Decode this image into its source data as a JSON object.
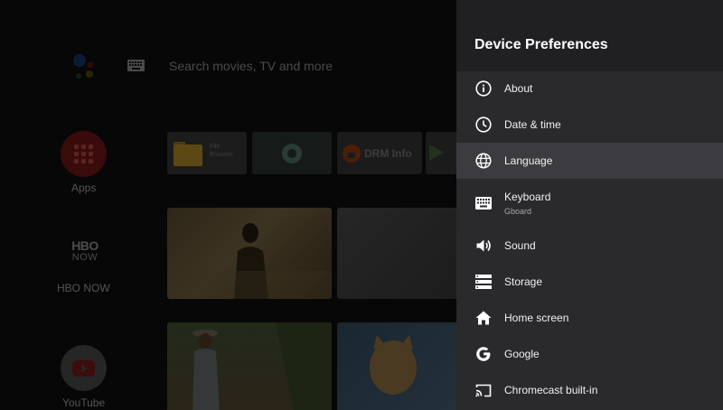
{
  "home": {
    "search_placeholder": "Search movies, TV and more",
    "favorites": [
      {
        "label": "Apps"
      },
      {
        "label": "HBO NOW",
        "logo_top": "HBO",
        "logo_bottom": "NOW"
      },
      {
        "label": "YouTube"
      }
    ],
    "app_tiles": [
      {
        "title": "File",
        "subtitle": "Browser"
      },
      {
        "title": ""
      },
      {
        "title": "DRM Info"
      },
      {
        "title": ""
      }
    ]
  },
  "panel": {
    "title": "Device Preferences",
    "items": [
      {
        "label": "About",
        "icon": "info-icon"
      },
      {
        "label": "Date & time",
        "icon": "clock-icon"
      },
      {
        "label": "Language",
        "icon": "globe-icon",
        "selected": true
      },
      {
        "label": "Keyboard",
        "sublabel": "Gboard",
        "icon": "keyboard-icon"
      },
      {
        "label": "Sound",
        "icon": "speaker-icon"
      },
      {
        "label": "Storage",
        "icon": "storage-icon"
      },
      {
        "label": "Home screen",
        "icon": "home-icon"
      },
      {
        "label": "Google",
        "icon": "google-icon"
      },
      {
        "label": "Chromecast built-in",
        "icon": "cast-icon"
      }
    ]
  },
  "colors": {
    "panel_bg": "#2a2a2d",
    "panel_header_bg": "#202023",
    "selected_row_bg": "#3c3c40",
    "home_bg": "#070707"
  }
}
